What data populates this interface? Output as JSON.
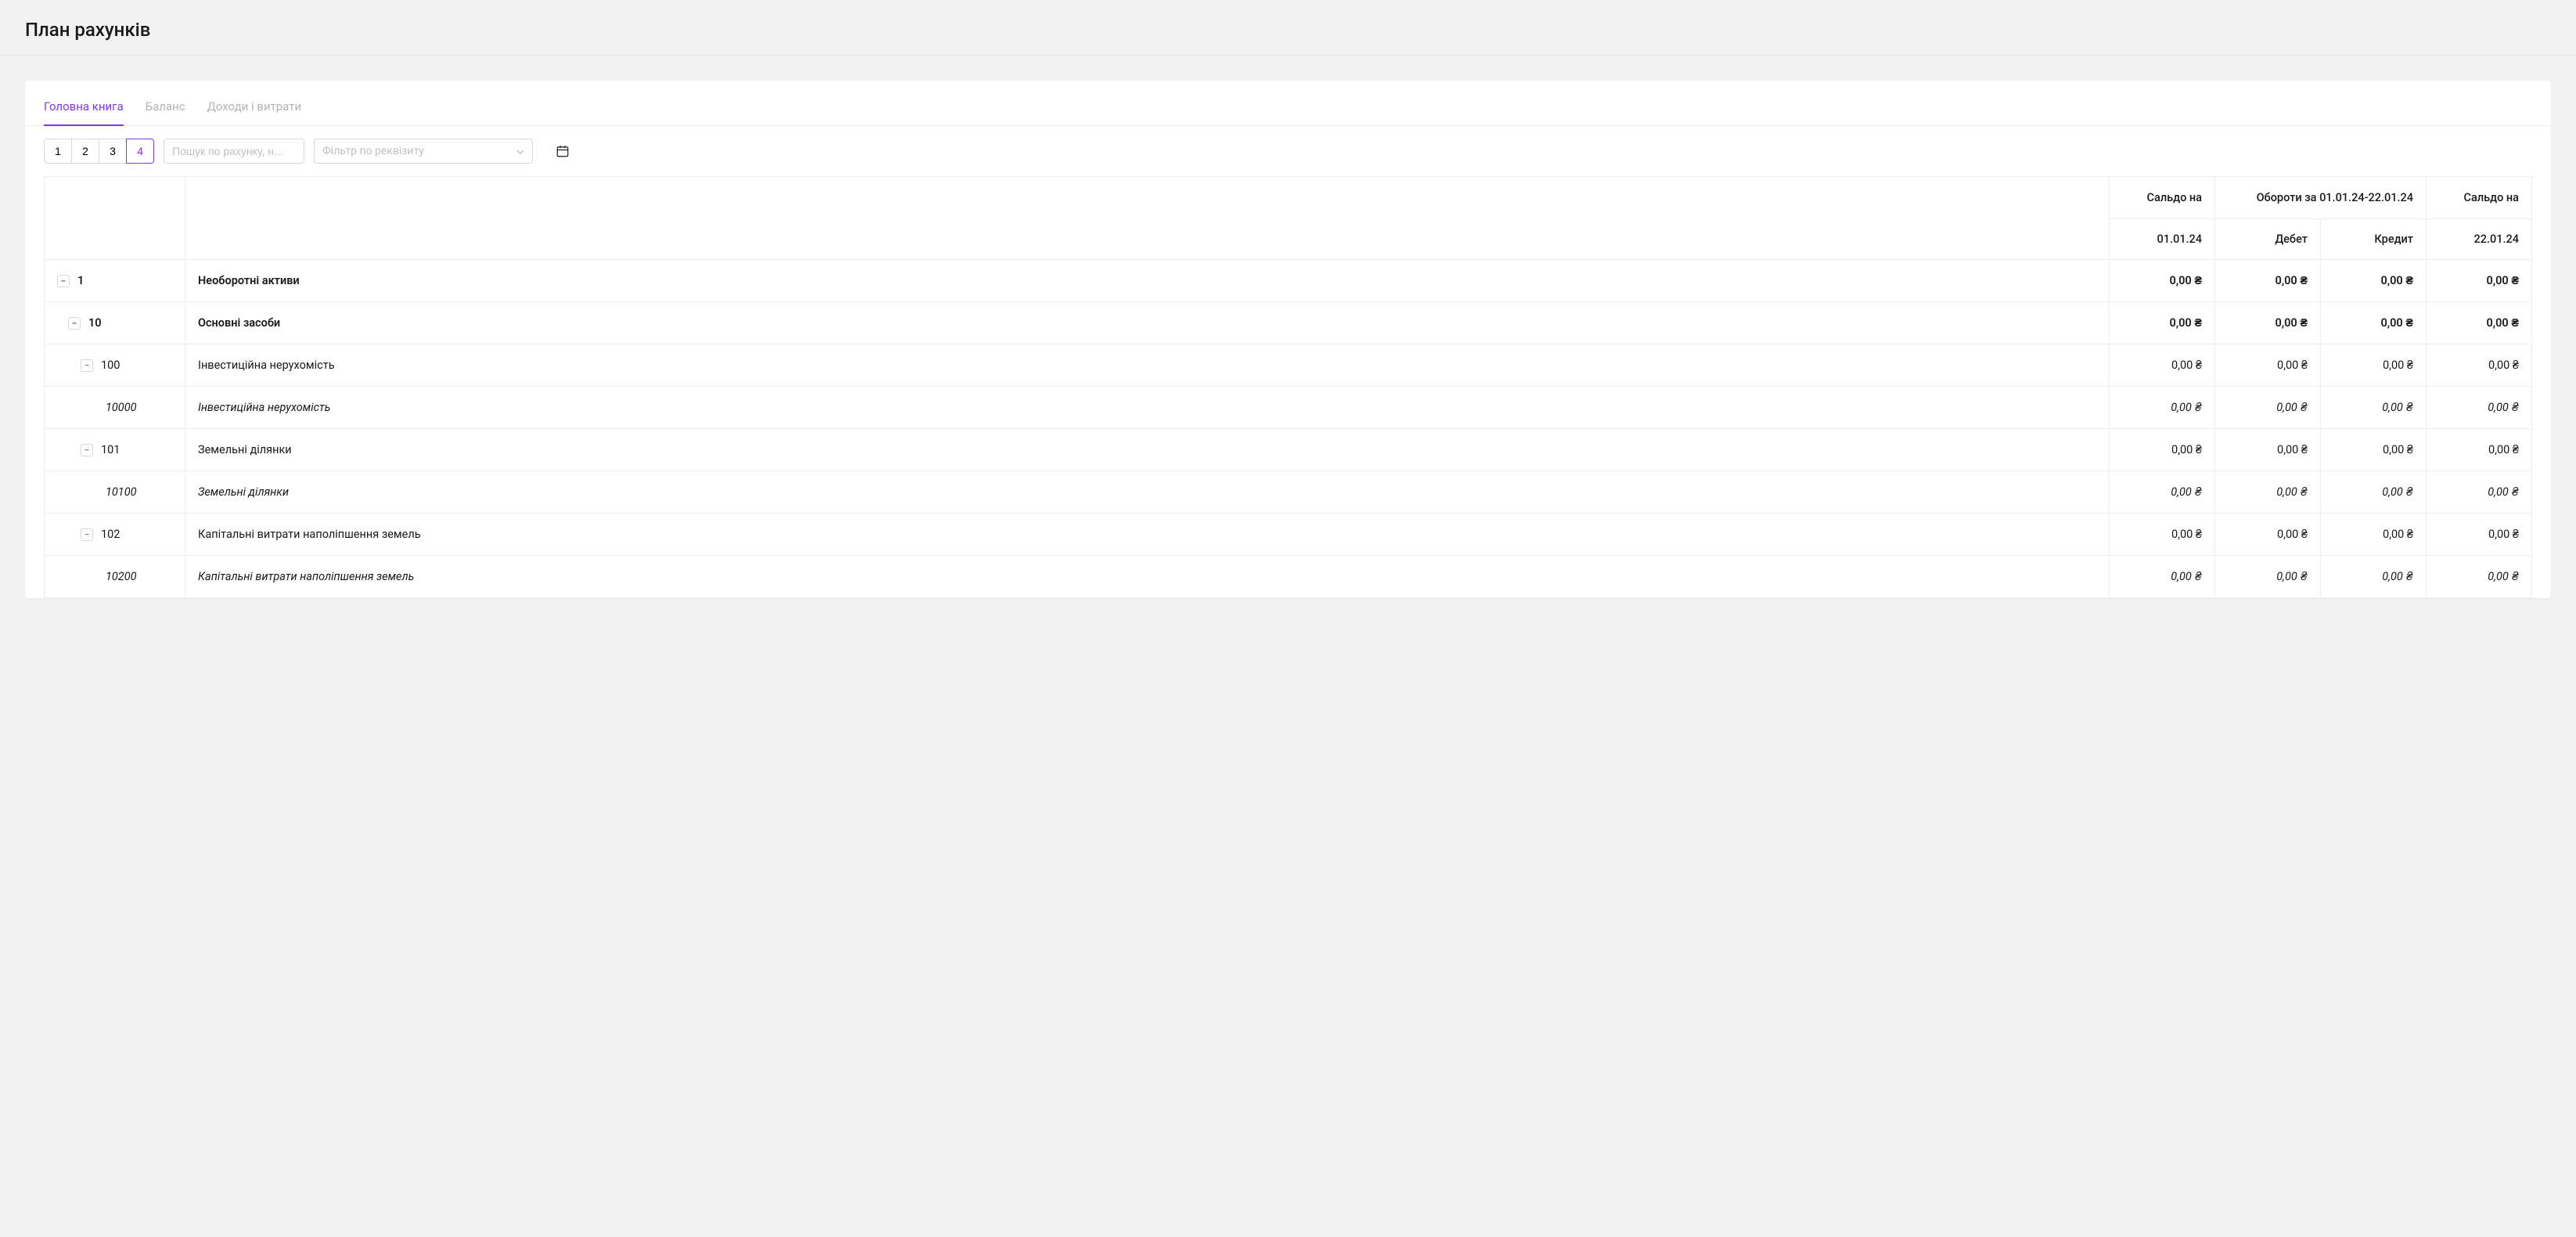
{
  "header": {
    "title": "План рахунків"
  },
  "tabs": [
    {
      "label": "Головна книга",
      "active": true
    },
    {
      "label": "Баланс",
      "active": false
    },
    {
      "label": "Доходи і витрати",
      "active": false
    }
  ],
  "toolbar": {
    "levels": [
      "1",
      "2",
      "3",
      "4"
    ],
    "active_level": "4",
    "search_placeholder": "Пошук по рахунку, н...",
    "filter_placeholder": "Фільтр по реквізиту"
  },
  "table": {
    "headers": {
      "balance_label": "Сальдо на",
      "turnover_label": "Обороти за 01.01.24-22.01.24",
      "start_date": "01.01.24",
      "debit": "Дебет",
      "credit": "Кредит",
      "end_date": "22.01.24"
    },
    "rows": [
      {
        "level": 0,
        "bold": true,
        "italic": false,
        "has_toggle": true,
        "code": "1",
        "name": "Необоротні активи",
        "b1": "0,00 ₴",
        "d": "0,00 ₴",
        "c": "0,00 ₴",
        "b2": "0,00 ₴"
      },
      {
        "level": 1,
        "bold": true,
        "italic": false,
        "has_toggle": true,
        "code": "10",
        "name": "Основні засоби",
        "b1": "0,00 ₴",
        "d": "0,00 ₴",
        "c": "0,00 ₴",
        "b2": "0,00 ₴"
      },
      {
        "level": 2,
        "bold": false,
        "italic": false,
        "has_toggle": true,
        "code": "100",
        "name": "Інвестиційна нерухомість",
        "b1": "0,00 ₴",
        "d": "0,00 ₴",
        "c": "0,00 ₴",
        "b2": "0,00 ₴"
      },
      {
        "level": 3,
        "bold": false,
        "italic": true,
        "has_toggle": false,
        "code": "10000",
        "name": "Інвестиційна нерухомість",
        "b1": "0,00 ₴",
        "d": "0,00 ₴",
        "c": "0,00 ₴",
        "b2": "0,00 ₴"
      },
      {
        "level": 2,
        "bold": false,
        "italic": false,
        "has_toggle": true,
        "code": "101",
        "name": "Земельні ділянки",
        "b1": "0,00 ₴",
        "d": "0,00 ₴",
        "c": "0,00 ₴",
        "b2": "0,00 ₴"
      },
      {
        "level": 3,
        "bold": false,
        "italic": true,
        "has_toggle": false,
        "code": "10100",
        "name": "Земельні ділянки",
        "b1": "0,00 ₴",
        "d": "0,00 ₴",
        "c": "0,00 ₴",
        "b2": "0,00 ₴"
      },
      {
        "level": 2,
        "bold": false,
        "italic": false,
        "has_toggle": true,
        "code": "102",
        "name": "Капітальні витрати наполіпшення земель",
        "b1": "0,00 ₴",
        "d": "0,00 ₴",
        "c": "0,00 ₴",
        "b2": "0,00 ₴"
      },
      {
        "level": 3,
        "bold": false,
        "italic": true,
        "has_toggle": false,
        "code": "10200",
        "name": "Капітальні витрати наполіпшення земель",
        "b1": "0,00 ₴",
        "d": "0,00 ₴",
        "c": "0,00 ₴",
        "b2": "0,00 ₴"
      }
    ]
  }
}
